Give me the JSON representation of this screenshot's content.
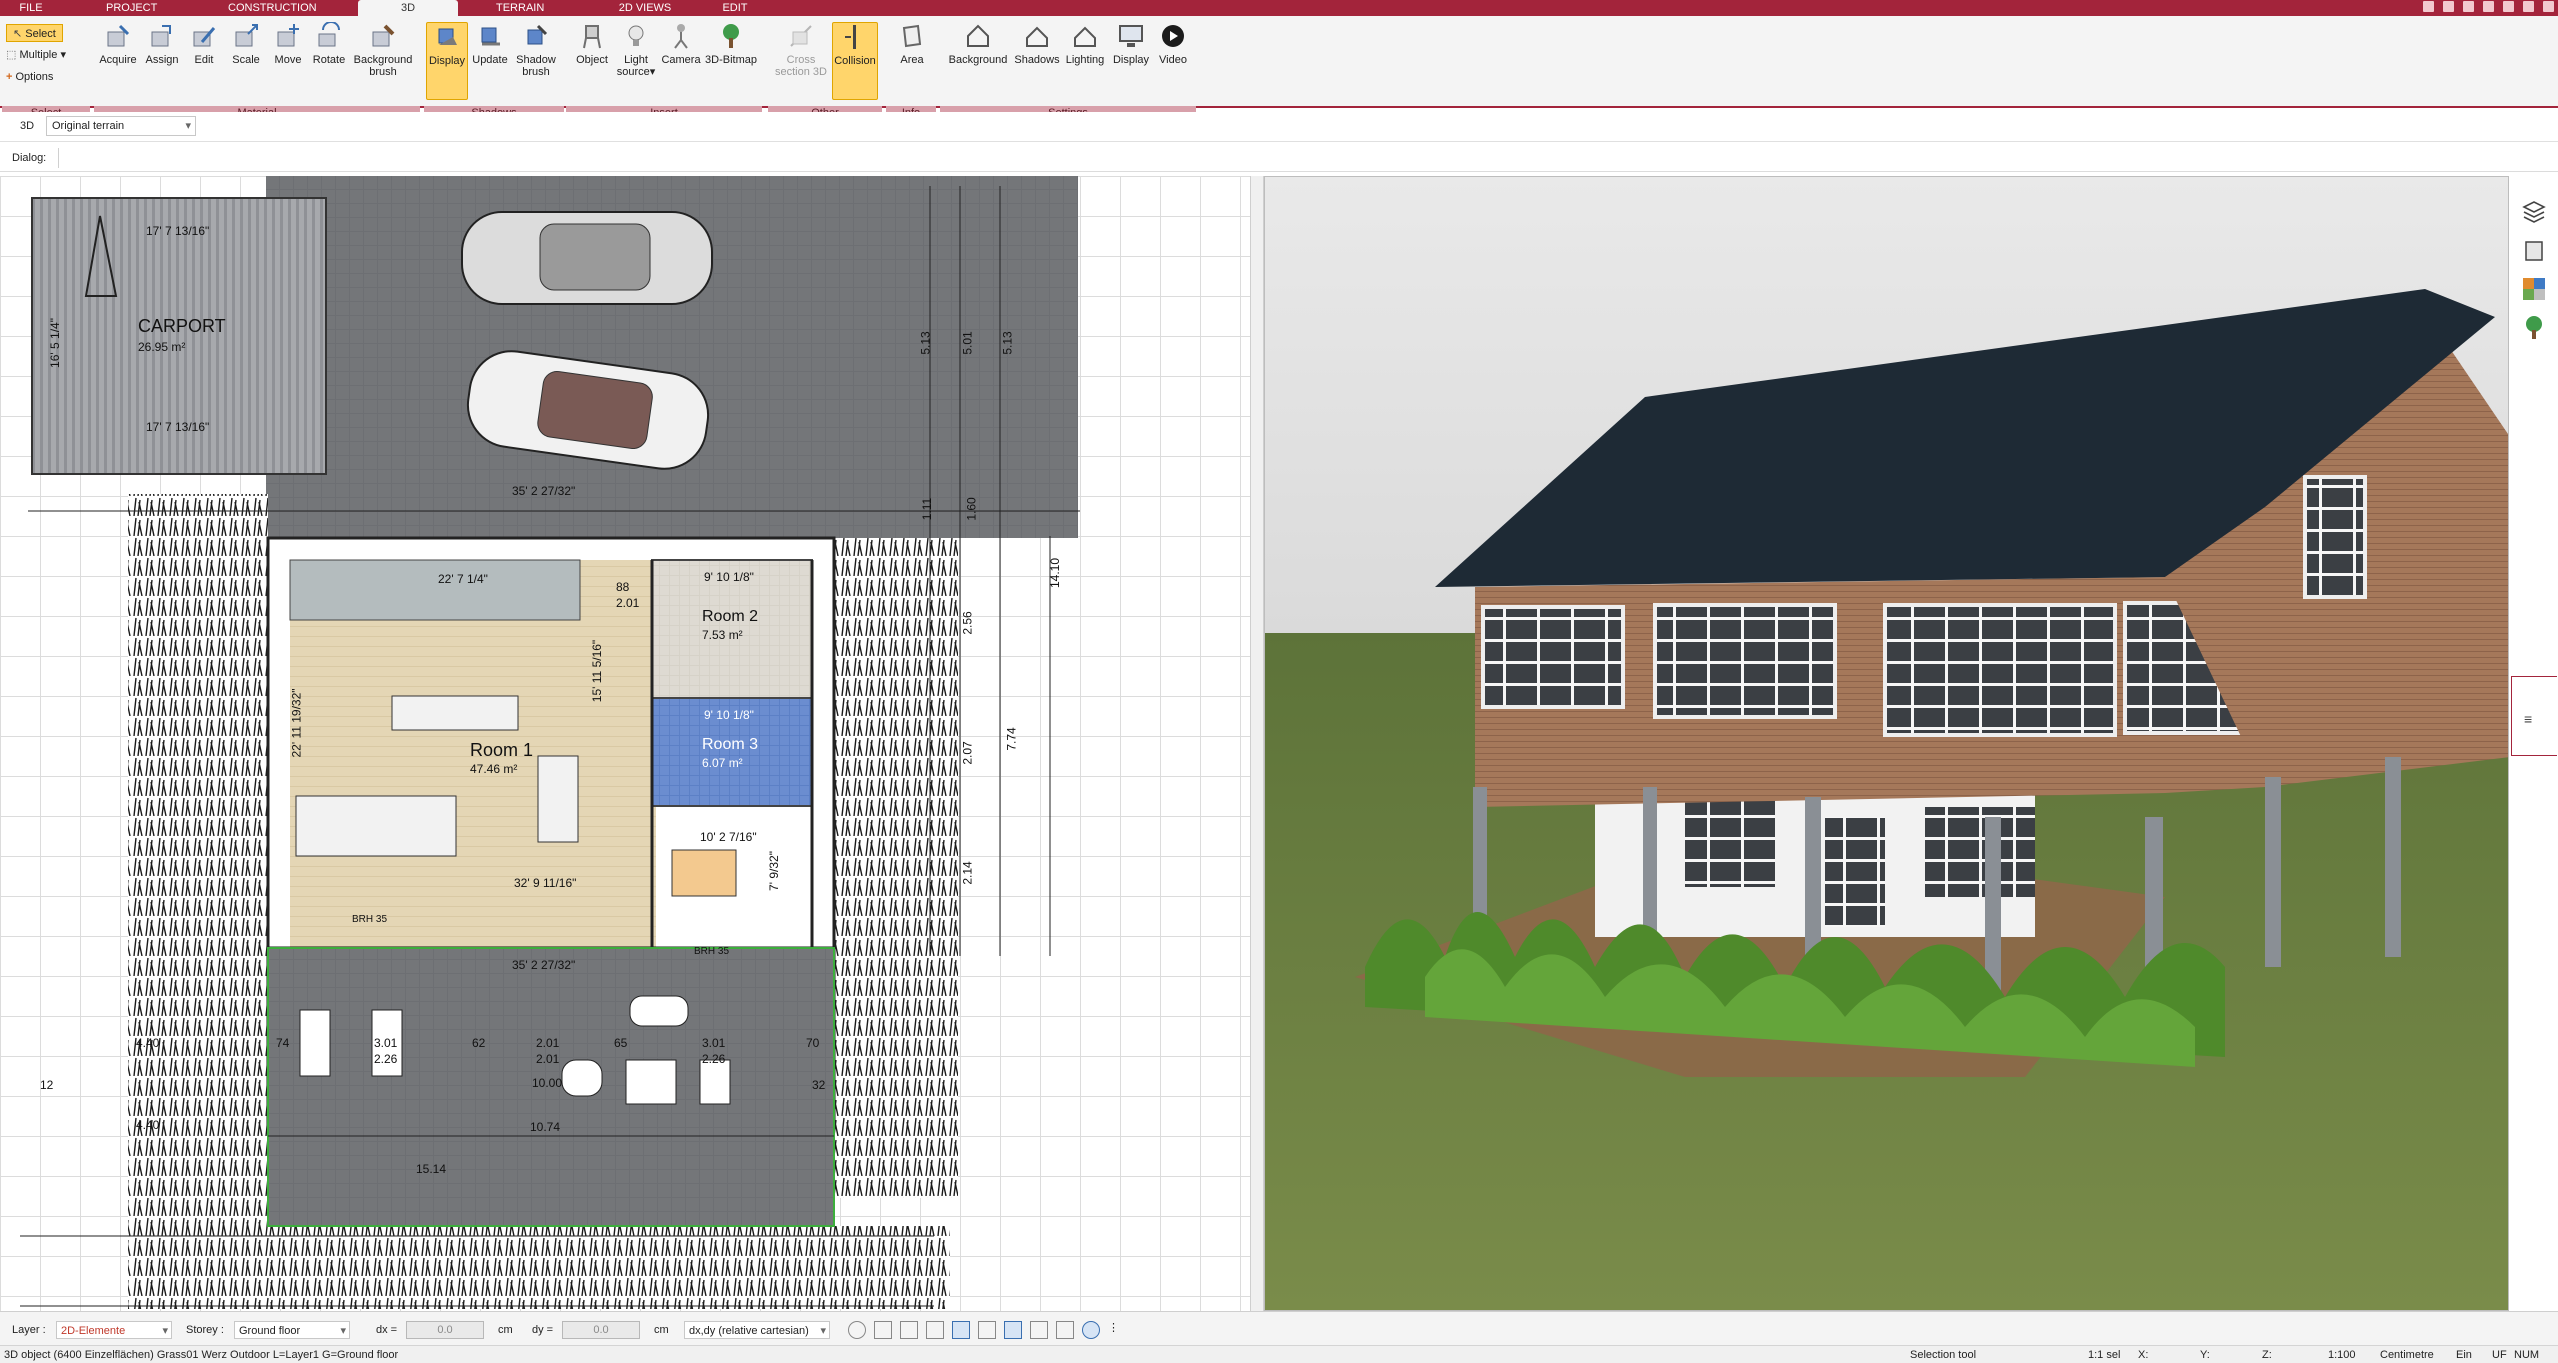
{
  "menu": {
    "tabs": [
      "FILE",
      "PROJECT",
      "CONSTRUCTION",
      "3D",
      "TERRAIN",
      "2D VIEWS",
      "EDIT"
    ],
    "active": "3D"
  },
  "ribbon": {
    "select_group": {
      "select": "Select",
      "multiple": "Multiple",
      "options": "Options",
      "label": "Select"
    },
    "material": {
      "label": "Material",
      "buttons": [
        "Acquire",
        "Assign",
        "Edit",
        "Scale",
        "Move",
        "Rotate"
      ],
      "background_brush_1": "Background",
      "background_brush_2": "brush"
    },
    "shadows": {
      "label": "Shadows",
      "display": "Display",
      "update": "Update",
      "shadow_brush_1": "Shadow",
      "shadow_brush_2": "brush"
    },
    "insert": {
      "label": "Insert",
      "object": "Object",
      "light_1": "Light",
      "light_2": "source",
      "camera": "Camera",
      "bitmap": "3D-Bitmap"
    },
    "other": {
      "label": "Other",
      "cross_1": "Cross",
      "cross_2": "section 3D",
      "collision": "Collision"
    },
    "info": {
      "label": "Info",
      "area": "Area"
    },
    "settings": {
      "label": "Settings",
      "buttons": [
        "Background",
        "Shadows",
        "Lighting",
        "Display",
        "Video"
      ]
    }
  },
  "viewbar": {
    "mode": "3D",
    "terrain": "Original terrain"
  },
  "dialogbar": {
    "label": "Dialog:"
  },
  "plan": {
    "carport_title": "CARPORT",
    "carport_area": "26.95 m²",
    "carport_dim_top": "17' 7 13/16\"",
    "carport_dim_bottom": "17' 7 13/16\"",
    "carport_dim_side": "16' 5 1/4\"",
    "drive_width": "35' 2 27/32\"",
    "room1": "Room 1",
    "room1_area": "47.46 m²",
    "room2": "Room 2",
    "room2_area": "7.53 m²",
    "room3": "Room 3",
    "room3_area": "6.07 m²",
    "dim_stairs": "22' 7 1/4\"",
    "dim_room1_v": "15' 11 5/16\"",
    "dim_room1_h": "32' 9 11/16\"",
    "dim_room1_left": "22' 11 19/32\"",
    "dim_r2_top": "9' 10 1/8\"",
    "dim_r3_top": "9' 10 1/8\"",
    "dim_kitchen": "10' 2 7/16\"",
    "dim_kitchen_v": "7' 9/32\"",
    "dim_88": "88",
    "dim_201": "2.01",
    "dim_terrace_top": "35' 2 27/32\"",
    "terrace_nums": [
      "4.40",
      "74",
      "3.01",
      "62",
      "2.01",
      "65",
      "3.01",
      "70",
      "2.26",
      "2.01",
      "2.26",
      "10.00",
      "4.40",
      "10.74",
      "15.14",
      "12",
      "32"
    ],
    "right_dims": [
      "5.13",
      "5.01",
      "5.13",
      "14.10",
      "7.74",
      "2.56",
      "2.07",
      "2.14",
      "1.60",
      "1.11"
    ],
    "brh": "BRH 35"
  },
  "bottombar": {
    "layer_label": "Layer :",
    "layer_value": "2D-Elemente",
    "storey_label": "Storey :",
    "storey_value": "Ground floor",
    "dx_label": "dx =",
    "dx_value": "0.0",
    "dy_label": "dy =",
    "dy_value": "0.0",
    "unit": "cm",
    "coord_mode": "dx,dy (relative cartesian)"
  },
  "statusbar": {
    "left": "3D object (6400 Einzelflächen) Grass01 Werz Outdoor L=Layer1 G=Ground floor",
    "tool": "Selection tool",
    "sel": "1:1 sel",
    "x": "X:",
    "y": "Y:",
    "z": "Z:",
    "scale": "1:100",
    "unit": "Centimetre",
    "ein": "Ein",
    "uf": "UF",
    "num": "NUM"
  },
  "colors": {
    "brand": "#a3243b",
    "ribbon": "#f4f4f4",
    "group_label": "#d8a0aa",
    "selected": "#ffd56b",
    "roof": "#1e2a35",
    "wood": "#a5785a",
    "lawn": "#6b8240",
    "sky": "#ececec"
  }
}
